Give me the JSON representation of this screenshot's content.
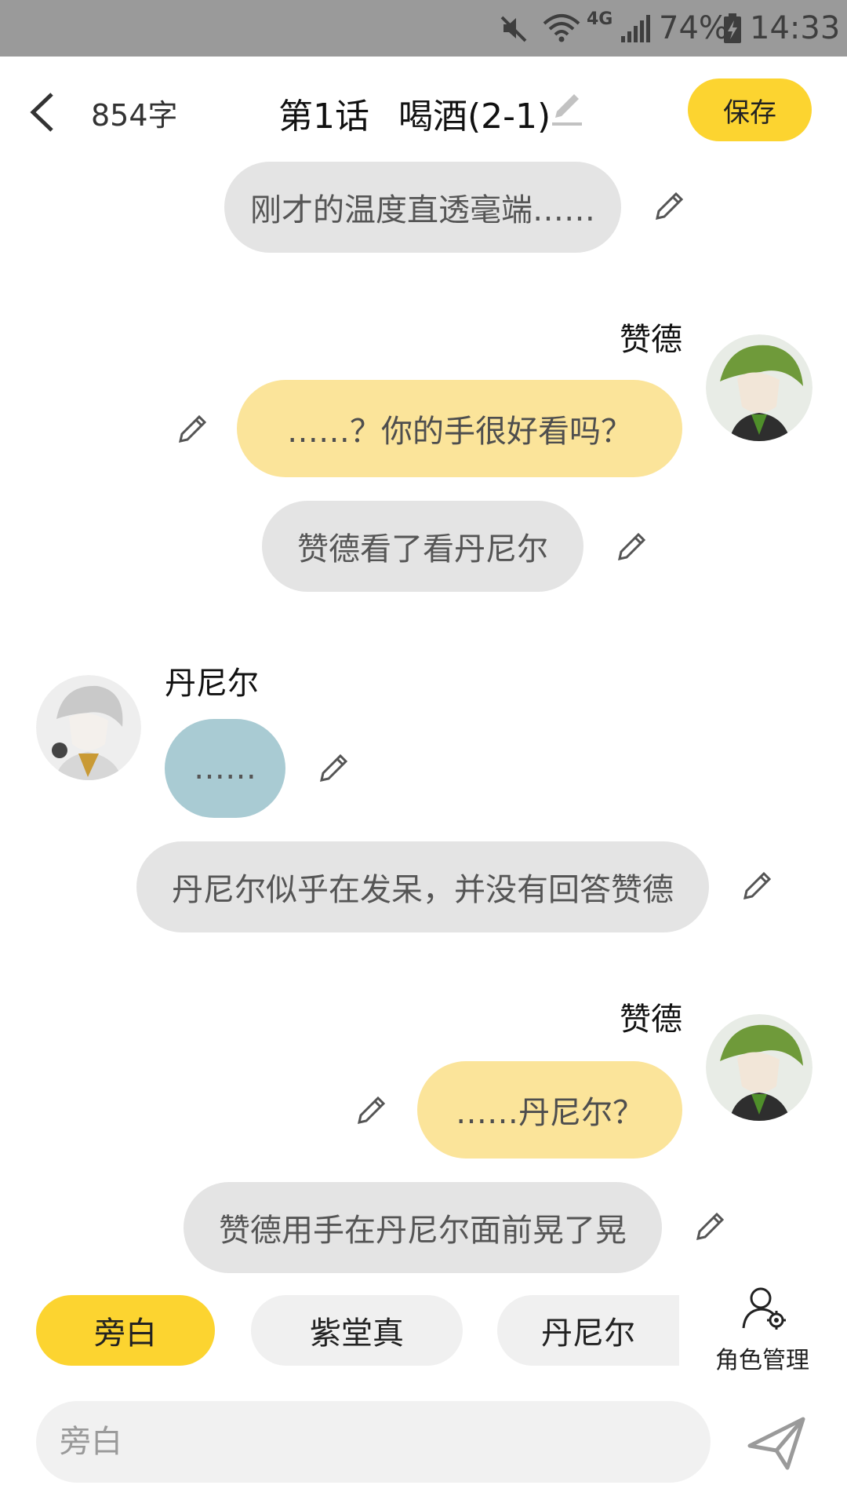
{
  "status_bar": {
    "network": "4G",
    "battery": "74%",
    "time": "14:33",
    "icons": [
      "mute-icon",
      "wifi-icon",
      "signal-icon",
      "battery-charging-icon"
    ]
  },
  "header": {
    "word_count": "854字",
    "chapter": "第1话",
    "title": "喝酒(2-1)",
    "save_label": "保存"
  },
  "messages": [
    {
      "type": "narration",
      "text": "刚才的温度直透毫端……"
    },
    {
      "type": "right",
      "speaker": "赞德",
      "text": "……？你的手很好看吗？"
    },
    {
      "type": "narration",
      "text": "赞德看了看丹尼尔"
    },
    {
      "type": "left",
      "speaker": "丹尼尔",
      "text": "……"
    },
    {
      "type": "narration",
      "text": "丹尼尔似乎在发呆，并没有回答赞德"
    },
    {
      "type": "right",
      "speaker": "赞德",
      "text": "……丹尼尔？"
    },
    {
      "type": "narration",
      "text": "赞德用手在丹尼尔面前晃了晃"
    }
  ],
  "roles": {
    "tabs": [
      "旁白",
      "紫堂真",
      "丹尼尔"
    ],
    "selected": "旁白",
    "manage_label": "角色管理"
  },
  "composer": {
    "placeholder": "旁白"
  },
  "colors": {
    "accent": "#fcd430",
    "narration_bubble": "#e4e4e4",
    "zande_bubble": "#fbe49a",
    "daniel_bubble": "#a9cbd3"
  }
}
